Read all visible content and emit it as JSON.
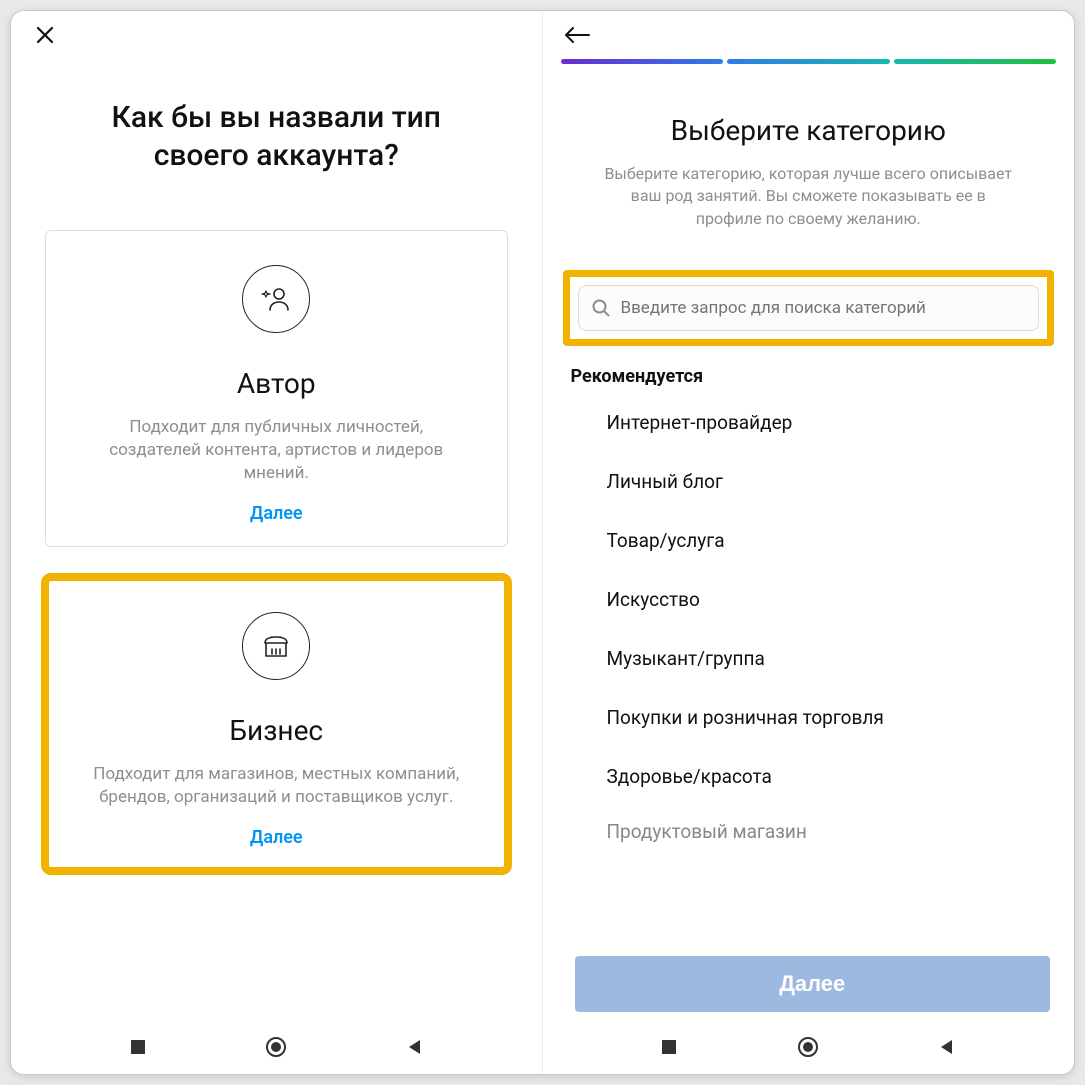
{
  "left": {
    "title": "Как бы вы назвали тип своего аккаунта?",
    "cards": [
      {
        "icon": "creator-icon",
        "title": "Автор",
        "desc": "Подходит для публичных личностей, создателей контента, артистов и лидеров мнений.",
        "next": "Далее",
        "highlight": false
      },
      {
        "icon": "business-icon",
        "title": "Бизнес",
        "desc": "Подходит для магазинов, местных компаний, брендов, организаций и поставщиков услуг.",
        "next": "Далее",
        "highlight": true
      }
    ]
  },
  "right": {
    "title": "Выберите категорию",
    "desc": "Выберите категорию, которая лучше всего описывает ваш род занятий. Вы сможете показывать ее в профиле по своему желанию.",
    "search_placeholder": "Введите запрос для поиска категорий",
    "recommended_label": "Рекомендуется",
    "categories": [
      "Интернет-провайдер",
      "Личный блог",
      "Товар/услуга",
      "Искусство",
      "Музыкант/группа",
      "Покупки и розничная торговля",
      "Здоровье/красота",
      "Продуктовый магазин"
    ],
    "next_button": "Далее"
  },
  "colors": {
    "highlight": "#f2b200",
    "link": "#0095f6",
    "next_bg": "#9db9e0"
  }
}
